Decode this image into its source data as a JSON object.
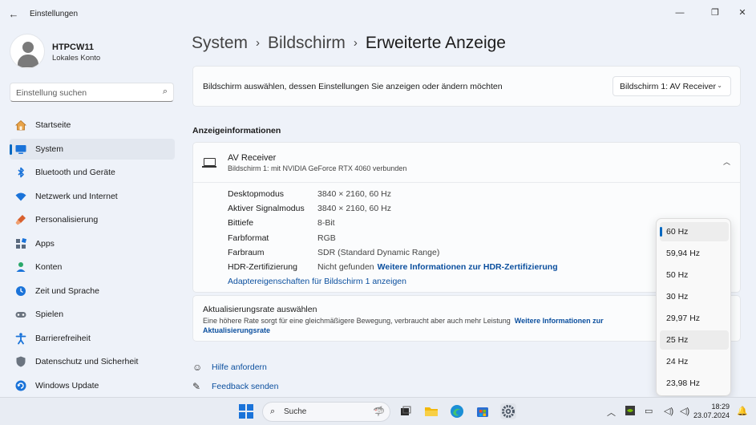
{
  "window": {
    "title": "Einstellungen",
    "back_icon": "←",
    "minimize_icon": "—",
    "maximize_icon": "❐",
    "close_icon": "✕"
  },
  "profile": {
    "name": "HTPCW11",
    "account": "Lokales Konto"
  },
  "search": {
    "placeholder": "Einstellung suchen"
  },
  "nav": {
    "items": [
      {
        "label": "Startseite",
        "icon": "home-icon"
      },
      {
        "label": "System",
        "icon": "system-icon",
        "active": true
      },
      {
        "label": "Bluetooth und Geräte",
        "icon": "bluetooth-icon"
      },
      {
        "label": "Netzwerk und Internet",
        "icon": "wifi-icon"
      },
      {
        "label": "Personalisierung",
        "icon": "brush-icon"
      },
      {
        "label": "Apps",
        "icon": "apps-icon"
      },
      {
        "label": "Konten",
        "icon": "account-icon"
      },
      {
        "label": "Zeit und Sprache",
        "icon": "globe-clock-icon"
      },
      {
        "label": "Spielen",
        "icon": "gamepad-icon"
      },
      {
        "label": "Barrierefreiheit",
        "icon": "accessibility-icon"
      },
      {
        "label": "Datenschutz und Sicherheit",
        "icon": "shield-icon"
      },
      {
        "label": "Windows Update",
        "icon": "update-icon"
      }
    ]
  },
  "breadcrumb": {
    "part1": "System",
    "part2": "Bildschirm",
    "current": "Erweiterte Anzeige"
  },
  "display_select": {
    "text": "Bildschirm auswählen, dessen Einstellungen Sie anzeigen oder ändern möchten",
    "value": "Bildschirm 1: AV Receiver"
  },
  "info_section": {
    "title": "Anzeigeinformationen",
    "device": "AV Receiver",
    "device_sub": "Bildschirm 1: mit NVIDIA GeForce RTX 4060 verbunden",
    "rows": [
      {
        "key": "Desktopmodus",
        "value": "3840 × 2160, 60 Hz"
      },
      {
        "key": "Aktiver Signalmodus",
        "value": "3840 × 2160, 60 Hz"
      },
      {
        "key": "Bittiefe",
        "value": "8-Bit"
      },
      {
        "key": "Farbformat",
        "value": "RGB"
      },
      {
        "key": "Farbraum",
        "value": "SDR (Standard Dynamic Range)"
      },
      {
        "key": "HDR-Zertifizierung",
        "value": "Nicht gefunden",
        "link": "Weitere Informationen zur HDR-Zertifizierung"
      }
    ],
    "adapter_link": "Adaptereigenschaften für Bildschirm 1 anzeigen"
  },
  "refresh": {
    "title": "Aktualisierungsrate auswählen",
    "desc": "Eine höhere Rate sorgt für eine gleichmäßigere Bewegung, verbraucht aber auch mehr Leistung",
    "link": "Weitere Informationen zur Aktualisierungsrate",
    "options": [
      "60 Hz",
      "59,94 Hz",
      "50 Hz",
      "30 Hz",
      "29,97 Hz",
      "25 Hz",
      "24 Hz",
      "23,98 Hz"
    ],
    "selected": "60 Hz",
    "hovered": "25 Hz"
  },
  "help": {
    "help_label": "Hilfe anfordern",
    "feedback_label": "Feedback senden"
  },
  "taskbar": {
    "search_label": "Suche",
    "time": "18:29",
    "date": "23.07.2024"
  }
}
